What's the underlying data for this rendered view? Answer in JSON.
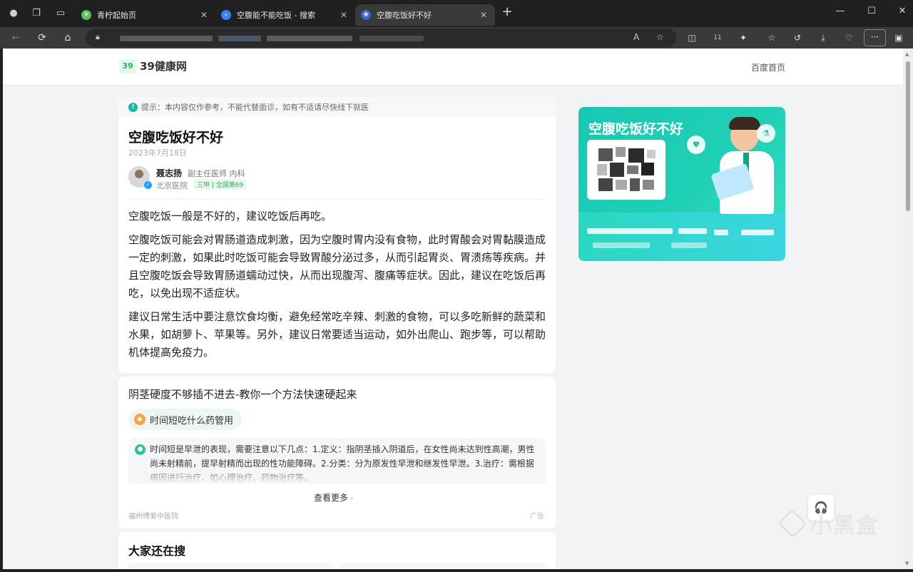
{
  "browser": {
    "tabs": [
      {
        "title": "青柠起始页",
        "favicon_color": "#5bbf5b",
        "active": false
      },
      {
        "title": "空腹能不能吃饭 - 搜索",
        "favicon_color": "#3b82f6",
        "active": false
      },
      {
        "title": "空腹吃饭好不好",
        "favicon_color": "#3b63d9",
        "active": true
      }
    ],
    "new_tab": "+",
    "window_controls": {
      "minimize": "—",
      "maximize": "☐",
      "close": "✕"
    },
    "nav": {
      "back": "←",
      "refresh": "⟳",
      "home": "⌂"
    },
    "more_label": "···",
    "extension_badge": "11"
  },
  "site": {
    "logo_mark": "39",
    "logo_text": "39健康网",
    "header_link": "百度首页"
  },
  "article": {
    "notice_icon": "!",
    "notice": "提示：本内容仅作参考，不能代替面诊，如有不适请尽快线下就医",
    "title": "空腹吃饭好不好",
    "date": "2023年7月18日",
    "doctor": {
      "name": "聂志扬",
      "title": "副主任医师 内科",
      "hospital": "北京医院",
      "badge": "三甲 | 全国第69"
    },
    "paragraphs": [
      "空腹吃饭一般是不好的，建议吃饭后再吃。",
      "空腹吃饭可能会对胃肠道造成刺激，因为空腹时胃内没有食物，此时胃酸会对胃黏膜造成一定的刺激，如果此时吃饭可能会导致胃酸分泌过多，从而引起胃炎、胃溃疡等疾病。并且空腹吃饭会导致胃肠道蠕动过快，从而出现腹泻、腹痛等症状。因此，建议在吃饭后再吃，以免出现不适症状。",
      "建议日常生活中要注意饮食均衡，避免经常吃辛辣、刺激的食物，可以多吃新鲜的蔬菜和水果，如胡萝卜、苹果等。另外，建议日常要适当运动，如外出爬山、跑步等，可以帮助机体提高免疫力。"
    ]
  },
  "ad_card": {
    "title": "阴茎硬度不够插不进去-教你一个方法快速硬起来",
    "question": "时间短吃什么药管用",
    "answer": "时间短是早泄的表现，需要注意以下几点：1.定义：指阴茎插入阴道后，在女性尚未达到性高潮，男性尚未射精前，提早射精而出现的性功能障碍。2.分类：分为原发性早泄和继发性早泄。3.治疗：需根据病因进行治疗，如心理治疗、药物治疗等。",
    "more": "查看更多",
    "source": "福州博爱中医院",
    "ad_label": "广告"
  },
  "related": {
    "title": "大家还在搜"
  },
  "banner": {
    "title": "空腹吃饭好不好"
  },
  "float_button_icon": "🎧",
  "watermark": "小黑盒"
}
